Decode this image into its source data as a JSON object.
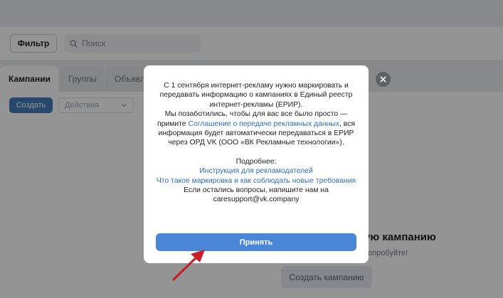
{
  "toolbar": {
    "filter_label": "Фильтр",
    "search_placeholder": "Поиск"
  },
  "tabs": [
    {
      "label": "Кампании"
    },
    {
      "label": "Группы"
    },
    {
      "label": "Объявл"
    }
  ],
  "content": {
    "create_label": "Создать",
    "actions_label": "Действия",
    "empty_title": "ную кампанию",
    "empty_subtitle": "опробуйте!",
    "create_campaign_label": "Создать кампанию"
  },
  "modal": {
    "p1": "С 1 сентября интернет-рекламу нужно маркировать и передавать информацию о кампаниях в Единый реестр интернет-рекламы (ЕРИР).",
    "p2_before": "Мы позаботились, чтобы для вас все было просто — примите ",
    "p2_link": "Соглашение о передаче рекламных данных",
    "p2_after": ", вся информация будет автоматически передаваться в ЕРИР через ОРД VK (ООО «ВК Рекламные технологии»).",
    "more_label": "Подробнее:",
    "link1": "Инструкция для рекламодателей",
    "link2": "Что такое маркировка и как соблюдать новые требования",
    "contact": "Если остались вопросы, напишите нам на caresupport@vk.company",
    "accept_label": "Принять"
  },
  "colors": {
    "accent": "#4a86d8",
    "link": "#2a6fc4",
    "arrow": "#c8202a"
  }
}
